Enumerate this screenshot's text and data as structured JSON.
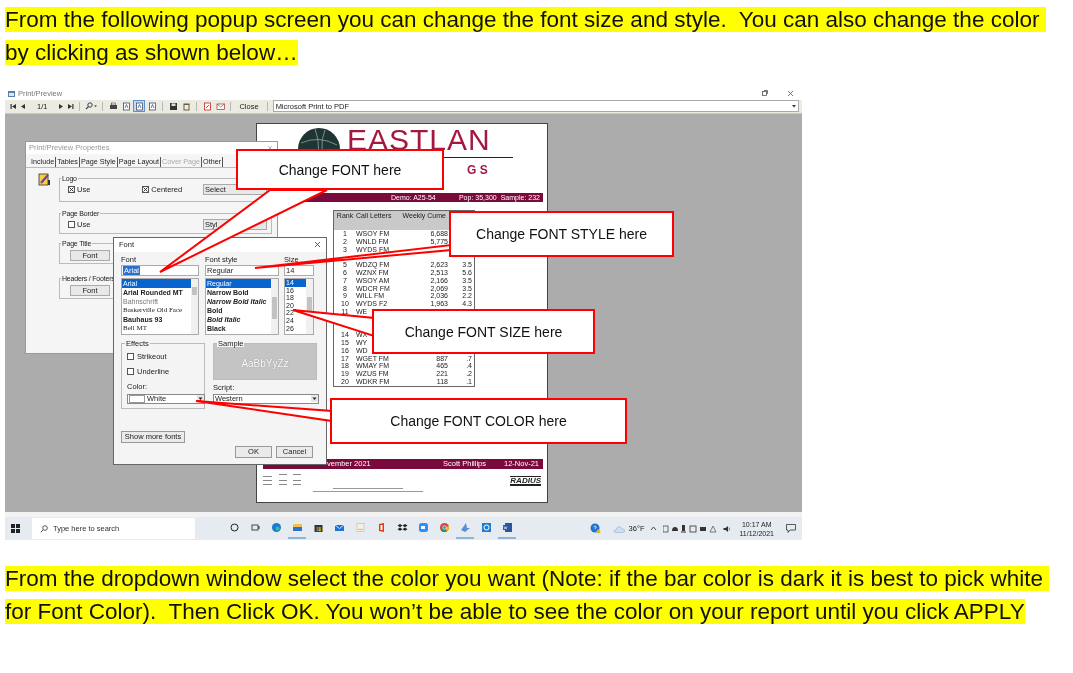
{
  "intro_text": "From the following popup screen you can change the font size and style.  You can also change the color by clicking as shown below…",
  "screenshot": {
    "window": {
      "title": "Print/Preview"
    },
    "toolbar": {
      "page": "1/1",
      "close": "Close",
      "printer": "Microsoft Print to PDF",
      "tools": [
        {
          "kind": "print",
          "selected": false
        },
        {
          "kind": "page",
          "selected": false
        },
        {
          "kind": "page",
          "selected": true
        },
        {
          "kind": "page",
          "selected": false
        },
        {
          "kind": "save",
          "selected": false
        },
        {
          "kind": "clipboard",
          "selected": false
        },
        {
          "kind": "pdf",
          "selected": false
        },
        {
          "kind": "email",
          "selected": false
        }
      ]
    },
    "report": {
      "brand": "EASTLAN",
      "brand_sub": "G S",
      "demo": "Demo: A25-54",
      "pop": "Pop: 35,300",
      "sample": "Sample: 232",
      "columns": [
        "Rank",
        "Call Letters",
        "Weekly Cume"
      ],
      "rows": [
        {
          "rank": "1",
          "call": "WSOY FM",
          "cume": "6,688"
        },
        {
          "rank": "2",
          "call": "WNLD FM",
          "cume": "5,775"
        },
        {
          "rank": "3",
          "call": "WYDS FM"
        },
        {},
        {
          "rank": "5",
          "call": "WDZQ FM",
          "cume": "2,623",
          "pct": "3.5"
        },
        {
          "rank": "6",
          "call": "WZNX FM",
          "cume": "2,513",
          "pct": "5.6"
        },
        {
          "rank": "7",
          "call": "WSOY AM",
          "cume": "2,166",
          "pct": "3.5"
        },
        {
          "rank": "8",
          "call": "WDCR FM",
          "cume": "2,069",
          "pct": "3.5"
        },
        {
          "rank": "9",
          "call": "WILL FM",
          "cume": "2,036",
          "pct": "2.2"
        },
        {
          "rank": "10",
          "call": "WYDS F2",
          "cume": "1,963",
          "pct": "4.3"
        },
        {
          "rank": "11",
          "call": "WE"
        },
        {},
        {},
        {
          "rank": "14",
          "call": "WX"
        },
        {
          "rank": "15",
          "call": "WY"
        },
        {
          "rank": "16",
          "call": "WD"
        },
        {
          "rank": "17",
          "call": "WGET FM",
          "cume": "887",
          "pct": ".7"
        },
        {
          "rank": "18",
          "call": "WMAY FM",
          "cume": "465",
          "pct": ".4"
        },
        {
          "rank": "19",
          "call": "WZUS FM",
          "cume": "221",
          "pct": ".2"
        },
        {
          "rank": "20",
          "call": "WDKR FM",
          "cume": "118",
          "pct": ".1"
        }
      ],
      "footer": {
        "period": "vember 2021",
        "author": "Scott Phillips",
        "date": "12-Nov-21",
        "logo": "RADIUS"
      }
    },
    "properties_dialog": {
      "title": "Print/Preview Properties",
      "tabs": [
        {
          "label": "Include",
          "disabled": false
        },
        {
          "label": "Tables",
          "disabled": false
        },
        {
          "label": "Page Style",
          "disabled": false
        },
        {
          "label": "Page Layout",
          "disabled": false
        },
        {
          "label": "Cover Page",
          "disabled": true
        },
        {
          "label": "Other",
          "disabled": false
        }
      ],
      "groups": [
        {
          "label": "Logo",
          "checks": [
            {
              "label": "Use",
              "checked": true
            },
            {
              "label": "Centered",
              "checked": true
            }
          ],
          "button": "Select"
        },
        {
          "label": "Page Border",
          "checks": [
            {
              "label": "Use",
              "checked": false
            }
          ],
          "button": "Styl"
        },
        {
          "label": "Page Title",
          "button": "Font"
        },
        {
          "label": "Headers / Footers",
          "button": "Font"
        }
      ]
    },
    "font_dialog": {
      "title": "Font",
      "font": {
        "label": "Font",
        "value": "Arial",
        "items": [
          {
            "label": "Arial",
            "kind": "sans",
            "selected": true
          },
          {
            "label": "Arial Rounded MT",
            "kind": "rounded",
            "selected": false
          },
          {
            "label": "Bahnschrift",
            "kind": "light",
            "selected": false
          },
          {
            "label": "Baskerville Old Face",
            "kind": "serif",
            "selected": false
          },
          {
            "label": "Bauhaus 93",
            "kind": "heavy",
            "selected": false
          },
          {
            "label": "Bell MT",
            "kind": "serif",
            "selected": false
          }
        ]
      },
      "style": {
        "label": "Font style",
        "value": "Regular",
        "items": [
          {
            "label": "Regular",
            "kind": "regular",
            "selected": true
          },
          {
            "label": "Narrow Bold",
            "kind": "bold",
            "selected": false
          },
          {
            "label": "Narrow Bold Italic",
            "kind": "bold-italic",
            "selected": false
          },
          {
            "label": "Bold",
            "kind": "bold",
            "selected": false
          },
          {
            "label": "Bold Italic",
            "kind": "bold-italic",
            "selected": false
          },
          {
            "label": "Black",
            "kind": "heavy",
            "selected": false
          }
        ]
      },
      "size": {
        "label": "Size",
        "value": "14",
        "items": [
          {
            "label": "14",
            "selected": true
          },
          {
            "label": "16",
            "selected": false
          },
          {
            "label": "18",
            "selected": false
          },
          {
            "label": "20",
            "selected": false
          },
          {
            "label": "22",
            "selected": false
          },
          {
            "label": "24",
            "selected": false
          },
          {
            "label": "26",
            "selected": false
          }
        ]
      },
      "effects": {
        "label": "Effects",
        "checks": [
          {
            "label": "Strikeout",
            "checked": false
          },
          {
            "label": "Underline",
            "checked": false
          }
        ],
        "color_label": "Color:",
        "color_value": "White"
      },
      "sample": {
        "label": "Sample",
        "text": "AaBbYyZz"
      },
      "script": {
        "label": "Script:",
        "value": "Western"
      },
      "buttons": {
        "more": "Show more fonts",
        "ok": "OK",
        "cancel": "Cancel"
      }
    },
    "callouts": [
      {
        "text": "Change FONT here"
      },
      {
        "text": "Change FONT STYLE here"
      },
      {
        "text": "Change FONT SIZE here"
      },
      {
        "text": "Change FONT COLOR here"
      }
    ],
    "taskbar": {
      "search_placeholder": "Type here to search",
      "apps": [
        {
          "kind": "cortana",
          "running": false
        },
        {
          "kind": "taskview",
          "running": false
        },
        {
          "kind": "edge",
          "running": false
        },
        {
          "kind": "files",
          "running": true
        },
        {
          "kind": "store",
          "running": false
        },
        {
          "kind": "mail",
          "running": false
        },
        {
          "kind": "tile",
          "running": false
        },
        {
          "kind": "office",
          "running": false
        },
        {
          "kind": "dropbox",
          "running": false
        },
        {
          "kind": "camera",
          "running": false
        },
        {
          "kind": "chrome",
          "running": false
        },
        {
          "kind": "arrow",
          "running": true
        },
        {
          "kind": "ring",
          "running": false
        },
        {
          "kind": "word",
          "running": true
        }
      ],
      "temperature": "36°F",
      "time": "10:17 AM",
      "date": "11/12/2021"
    }
  },
  "outro_text": "From the dropdown window select the color you want (Note: if the bar color is dark it is best to pick white for Font Color).  Then Click OK. You won’t be able to see the color on your report until you click APPLY"
}
